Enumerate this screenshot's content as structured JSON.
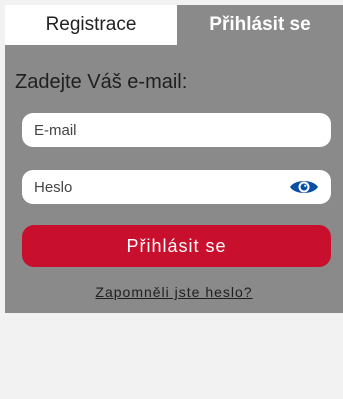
{
  "tabs": {
    "register_label": "Registrace",
    "login_label": "Přihlásit se"
  },
  "form": {
    "prompt": "Zadejte Váš e-mail:",
    "email_placeholder": "E-mail",
    "password_placeholder": "Heslo",
    "submit_label": "Přihlásit se",
    "forgot_label": "Zapomněli jste heslo?"
  },
  "icons": {
    "password_toggle": "eye-icon"
  },
  "colors": {
    "panel": "#8a8a8a",
    "accent": "#c8102e",
    "eye_icon": "#0a4fa3"
  }
}
